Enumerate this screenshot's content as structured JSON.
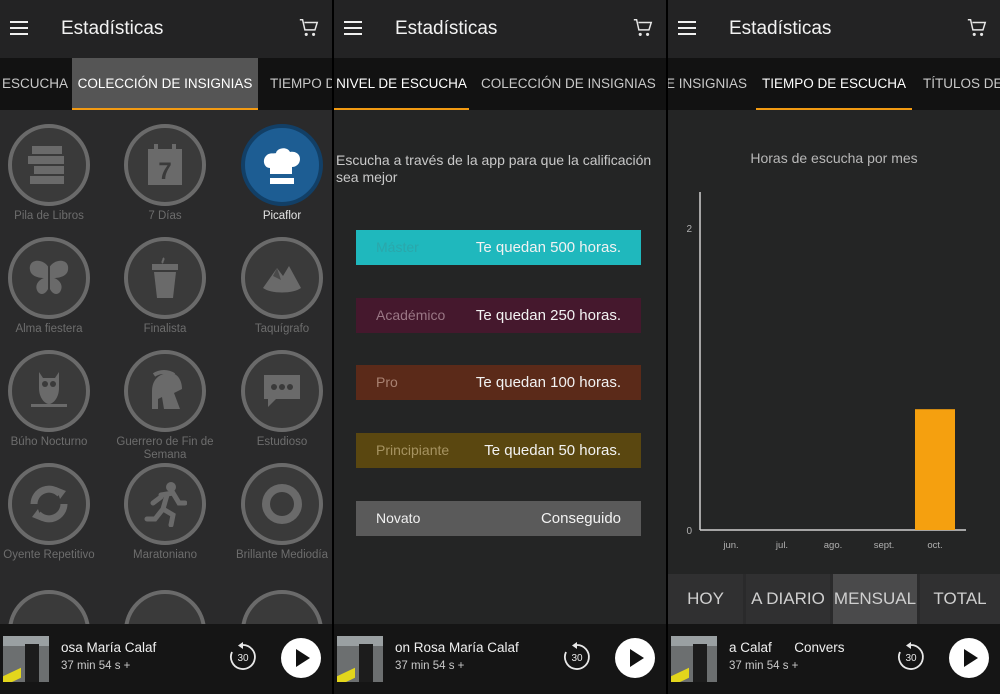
{
  "app": {
    "title": "Estadísticas"
  },
  "panel1": {
    "tabs": [
      "ESCUCHA",
      "COLECCIÓN DE INSIGNIAS",
      "TIEMPO D"
    ],
    "badges": [
      "Pila de Libros",
      "7 Días",
      "Picaflor",
      "Alma fiestera",
      "Finalista",
      "Taquígrafo",
      "Búho Nocturno",
      "Guerrero de Fin de Semana",
      "Estudioso",
      "Oyente Repetitivo",
      "Maratoniano",
      "Brillante Mediodía"
    ],
    "calendar_number": "7"
  },
  "panel2": {
    "tabs": [
      "NIVEL DE ESCUCHA",
      "COLECCIÓN DE INSIGNIAS"
    ],
    "hint": "Escucha a través de la app para que la calificación sea mejor",
    "levels": [
      {
        "name": "Máster",
        "remaining": "Te quedan 500 horas.",
        "color": "#1fb8bd",
        "name_color": "#2aa7ab"
      },
      {
        "name": "Académico",
        "remaining": "Te quedan 250 horas.",
        "color": "#45182d",
        "name_color": "#9a7785"
      },
      {
        "name": "Pro",
        "remaining": "Te quedan 100 horas.",
        "color": "#5b2a19",
        "name_color": "#a98272"
      },
      {
        "name": "Principiante",
        "remaining": "Te quedan 50 horas.",
        "color": "#5a4710",
        "name_color": "#a69361"
      },
      {
        "name": "Novato",
        "remaining": "Conseguido",
        "color": "#5a5a5a",
        "name_color": "#f0f0f0"
      }
    ]
  },
  "panel3": {
    "tabs": [
      "E INSIGNIAS",
      "TIEMPO DE ESCUCHA",
      "TÍTULOS DE"
    ],
    "chart_title": "Horas de escucha por mes",
    "periods": [
      "HOY",
      "A DIARIO",
      "MENSUAL",
      "TOTAL"
    ]
  },
  "chart_data": {
    "type": "bar",
    "title": "Horas de escucha por mes",
    "categories": [
      "jun.",
      "jul.",
      "ago.",
      "sept.",
      "oct."
    ],
    "values": [
      0,
      0,
      0,
      0,
      0.8
    ],
    "y_ticks": [
      "0",
      "2"
    ],
    "ylim": [
      0,
      2
    ],
    "bar_color": "#f5a00f",
    "grid": false
  },
  "player": {
    "titles": [
      "osa María Calaf",
      "on Rosa María Calaf",
      "a Calaf      Convers"
    ],
    "time": "37 min 54 s +",
    "rewind_label": "30"
  }
}
